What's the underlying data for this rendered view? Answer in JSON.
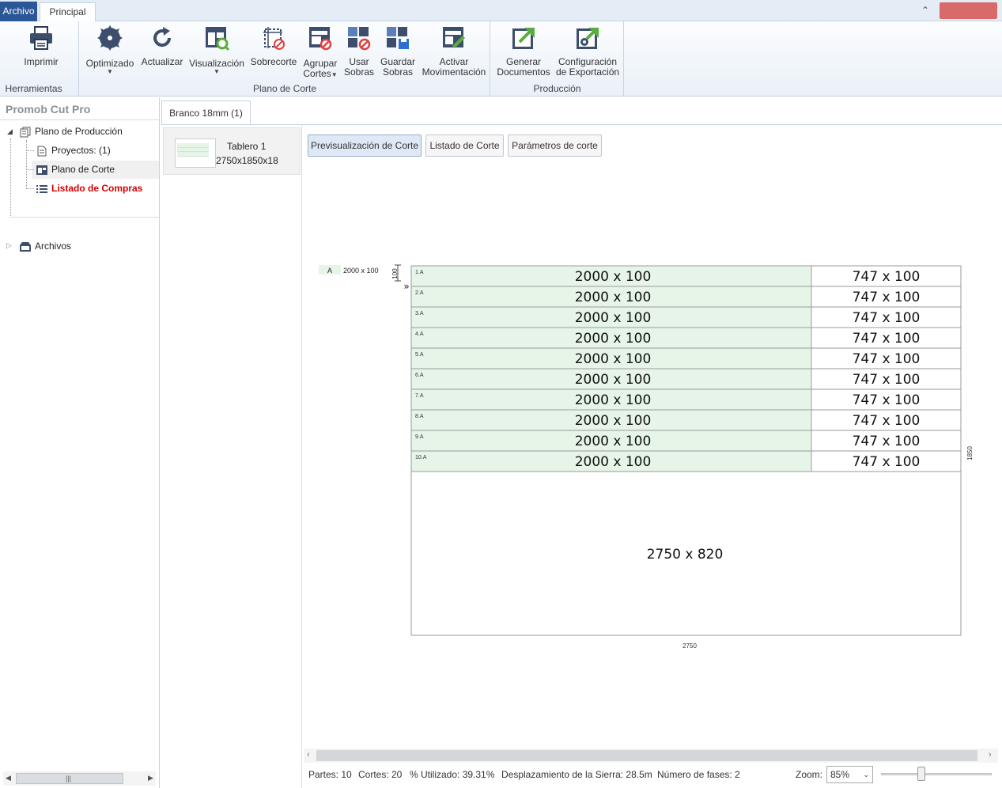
{
  "tabs": {
    "archivo": "Archivo",
    "principal": "Principal"
  },
  "ribbon": {
    "groups": {
      "herramientas": "Herramientas",
      "plano_de_corte": "Plano de Corte",
      "produccion": "Producción"
    },
    "buttons": {
      "imprimir": "Imprimir",
      "optimizado": "Optimizado",
      "actualizar": "Actualizar",
      "visualizacion": "Visualización",
      "sobrecorte": "Sobrecorte",
      "agrupar_1": "Agrupar",
      "agrupar_2": "Cortes",
      "usar_1": "Usar",
      "usar_2": "Sobras",
      "guardar_1": "Guardar",
      "guardar_2": "Sobras",
      "activar_1": "Activar",
      "activar_2": "Movimentación",
      "generar_1": "Generar",
      "generar_2": "Documentos",
      "config_1": "Configuración",
      "config_2": "de Exportación"
    },
    "icons": {
      "imprimir": "printer-icon",
      "optimizado": "saw-blade-icon",
      "actualizar": "refresh-icon",
      "visualizacion": "view-search-icon",
      "sobrecorte": "overcut-icon",
      "agrupar": "group-cuts-icon",
      "usar": "use-leftovers-icon",
      "guardar": "save-leftovers-icon",
      "activar": "activate-movement-icon",
      "generar": "generate-documents-icon",
      "config": "export-config-icon"
    }
  },
  "left_panel": {
    "title": "Promob Cut Pro",
    "tree": {
      "plano_produccion": "Plano de Producción",
      "proyectos": "Proyectos: (1)",
      "plano_corte": "Plano de Corte",
      "listado_compras": "Listado de Compras",
      "archivos": "Archivos"
    }
  },
  "doc_tab": "Branco 18mm (1)",
  "board": {
    "name": "Tablero 1",
    "size": "2750x1850x18"
  },
  "subtabs": {
    "preview": "Previsualización de Corte",
    "listado": "Listado de Corte",
    "parametros": "Parámetros de corte"
  },
  "cut_plan": {
    "legend_letter": "A",
    "legend_size": "2000 x 100",
    "strip_dim": "100",
    "width_label": "2750",
    "height_label": "1850",
    "rows": [
      {
        "id": "1.A",
        "main": "2000 x 100",
        "rest": "747 x 100"
      },
      {
        "id": "2.A",
        "main": "2000 x 100",
        "rest": "747 x 100"
      },
      {
        "id": "3.A",
        "main": "2000 x 100",
        "rest": "747 x 100"
      },
      {
        "id": "4.A",
        "main": "2000 x 100",
        "rest": "747 x 100"
      },
      {
        "id": "5.A",
        "main": "2000 x 100",
        "rest": "747 x 100"
      },
      {
        "id": "6.A",
        "main": "2000 x 100",
        "rest": "747 x 100"
      },
      {
        "id": "7.A",
        "main": "2000 x 100",
        "rest": "747 x 100"
      },
      {
        "id": "8.A",
        "main": "2000 x 100",
        "rest": "747 x 100"
      },
      {
        "id": "9.A",
        "main": "2000 x 100",
        "rest": "747 x 100"
      },
      {
        "id": "10.A",
        "main": "2000 x 100",
        "rest": "747 x 100"
      }
    ],
    "leftover": "2750 x 820",
    "colors": {
      "part": "#e6f5e8",
      "leftover": "#ffffff",
      "border": "#9a9a9a"
    }
  },
  "status": {
    "partes": "Partes: 10",
    "cortes": "Cortes: 20",
    "utilizado": "% Utilizado: 39.31%",
    "desplazamiento": "Desplazamiento de la Sierra: 28.5m",
    "fases": "Número de fases: 2",
    "zoom_label": "Zoom:",
    "zoom_value": "85%",
    "zoom_level": 0.36
  },
  "colors": {
    "accent": "#2b5797",
    "close": "#d86a6a",
    "shopping_list": "#d40000"
  }
}
